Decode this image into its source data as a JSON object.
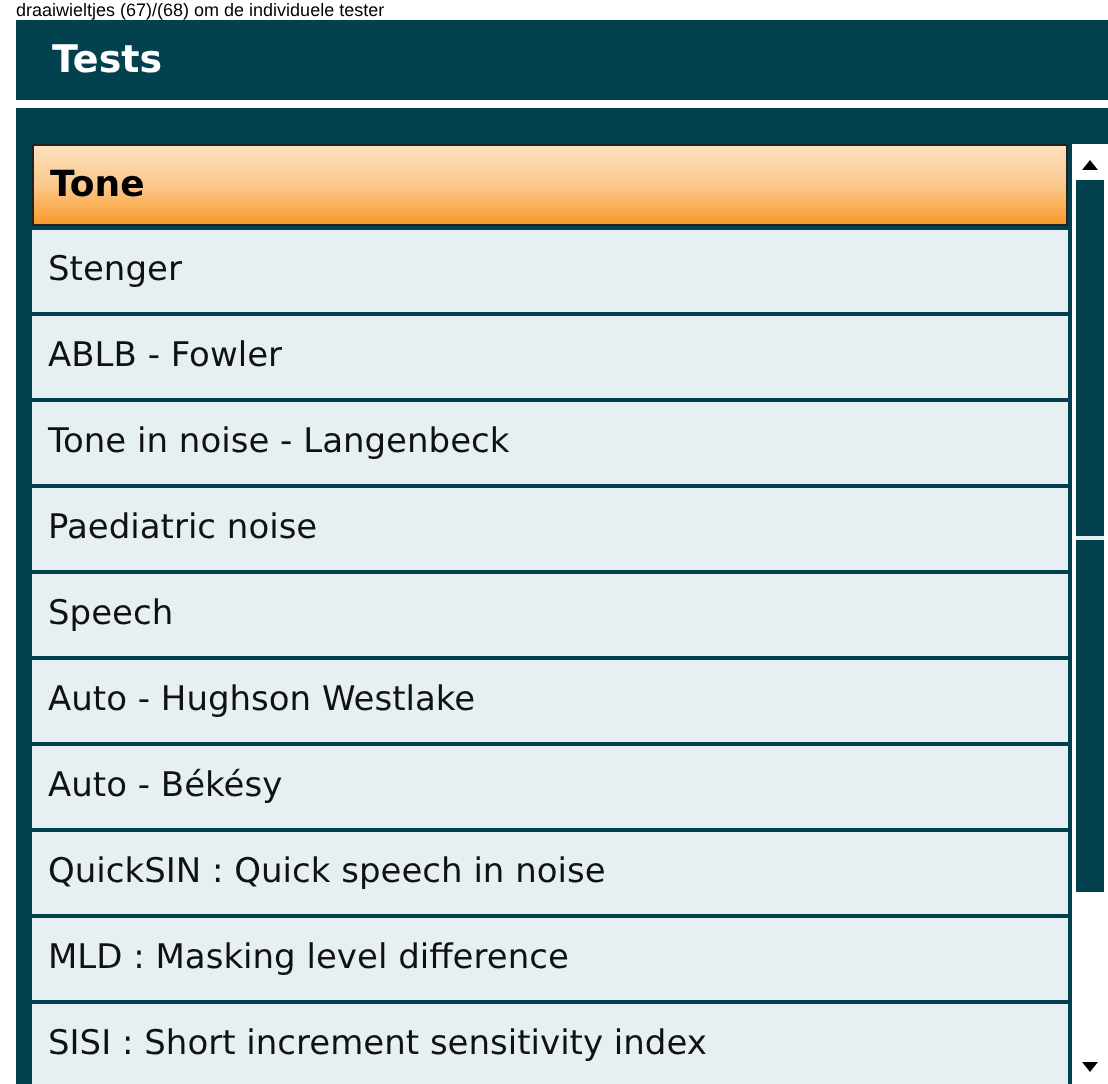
{
  "caption": "draaiwieltjes (67)/(68) om de individuele tester",
  "panel": {
    "title": "Tests"
  },
  "tests": [
    {
      "label": "Tone",
      "selected": true
    },
    {
      "label": "Stenger",
      "selected": false
    },
    {
      "label": "ABLB - Fowler",
      "selected": false
    },
    {
      "label": "Tone in noise - Langenbeck",
      "selected": false
    },
    {
      "label": "Paediatric noise",
      "selected": false
    },
    {
      "label": "Speech",
      "selected": false
    },
    {
      "label": "Auto - Hughson Westlake",
      "selected": false
    },
    {
      "label": "Auto - Békésy",
      "selected": false
    },
    {
      "label": "QuickSIN : Quick speech in noise",
      "selected": false
    },
    {
      "label": "MLD : Masking level difference",
      "selected": false
    },
    {
      "label": "SISI : Short increment sensitivity index",
      "selected": false
    }
  ]
}
